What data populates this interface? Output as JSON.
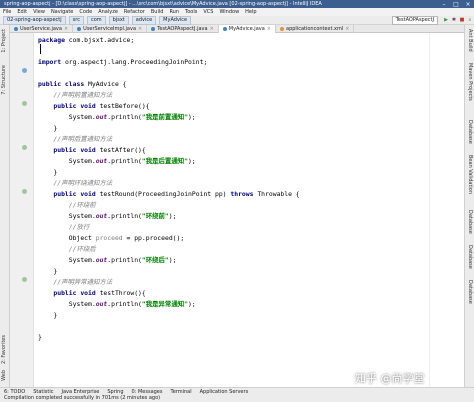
{
  "window": {
    "title": "spring-aop-aspectj - [D:\\class\\spring-aop-aspectj] - ...\\src\\com\\bjsxt\\advice\\MyAdvice.java [02-spring-aop-aspectj] - IntelliJ IDEA"
  },
  "menu": [
    "File",
    "Edit",
    "View",
    "Navigate",
    "Code",
    "Analyze",
    "Refactor",
    "Build",
    "Run",
    "Tools",
    "VCS",
    "Window",
    "Help"
  ],
  "nav": {
    "crumbs": [
      "02-spring-aop-aspectj",
      "src",
      "com",
      "bjsxt",
      "advice",
      "MyAdvice"
    ],
    "run_config": "TestAOPAspectJ"
  },
  "tabs": [
    {
      "label": "UserService.java",
      "active": false
    },
    {
      "label": "UserServiceImpl.java",
      "active": false
    },
    {
      "label": "TestAOPAspectJ.java",
      "active": false
    },
    {
      "label": "MyAdvice.java",
      "active": true
    },
    {
      "label": "applicationcontext.xml",
      "active": false
    }
  ],
  "left_tools": [
    "1: Project",
    "7: Structure",
    "2: Favorites",
    "Web"
  ],
  "right_tools": [
    "Ant Build",
    "Maven Projects",
    "Database",
    "Bean Validation",
    "Database",
    "Database",
    "Database"
  ],
  "code": {
    "package_kw": "package",
    "package_name": " com.bjsxt.advice;",
    "import_kw": "import",
    "import_name": " org.aspectj.lang.ProceedingJoinPoint;",
    "class_kw": "public class",
    "class_name": " MyAdvice {",
    "c_before": "//声明前置通知方法",
    "m_void": "public void",
    "m_before": " testBefore(){",
    "sys": "System.",
    "out": "out",
    "println": ".println(",
    "s_before": "\"我是前置通知\"",
    "end_call": ");",
    "close": "}",
    "c_after": "//声明后置通知方法",
    "m_after": " testAfter(){",
    "s_after": "\"我是后置通知\"",
    "c_round": "//声明环绕通知方法",
    "m_round": " testRound(ProceedingJoinPoint pp) ",
    "throws_kw": "throws",
    "throwable": " Throwable {",
    "c_round1": "//环绕前",
    "s_round1": "\"环绕前\"",
    "c_exec": "//放行",
    "obj": "Object ",
    "proceed_var": "proceed",
    "proceed_call": " = pp.proceed();",
    "c_round2": "//环绕后",
    "s_round2": "\"环绕后\"",
    "c_throw": "//声明异常通知方法",
    "m_throw": " testThrow(){",
    "s_throw": "\"我是异常通知\""
  },
  "toolwindows": [
    "6: TODO",
    "Statistic",
    "Java Enterprise",
    "Spring",
    "0: Messages",
    "Terminal",
    "Application Servers"
  ],
  "status": {
    "message": "Compilation completed successfully in 701ms (2 minutes ago)"
  },
  "watermark": "知乎 @尚学堂",
  "colors": {
    "keyword": "#000080",
    "comment": "#808080",
    "string": "#008000",
    "field": "#660e7a",
    "title_bar": "#3c5f8f"
  }
}
